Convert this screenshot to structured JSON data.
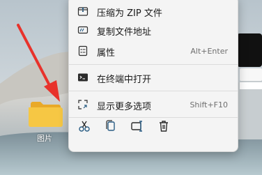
{
  "desktop": {
    "folder": {
      "label": "图片",
      "icon": "folder-icon"
    }
  },
  "context_menu": {
    "items": [
      {
        "label": "压缩为 ZIP 文件",
        "icon": "zip-icon",
        "shortcut": ""
      },
      {
        "label": "复制文件地址",
        "icon": "copy-path-icon",
        "shortcut": ""
      },
      {
        "label": "属性",
        "icon": "properties-icon",
        "shortcut": "Alt+Enter"
      },
      {
        "label": "在终端中打开",
        "icon": "terminal-icon",
        "shortcut": ""
      },
      {
        "label": "显示更多选项",
        "icon": "more-options-icon",
        "shortcut": "Shift+F10"
      }
    ],
    "toolbar": [
      "cut-icon",
      "copy-icon",
      "rename-icon",
      "delete-icon"
    ]
  },
  "colors": {
    "arrow": "#e8322b",
    "accent": "#2a5d84",
    "folder": "#f5c542"
  }
}
